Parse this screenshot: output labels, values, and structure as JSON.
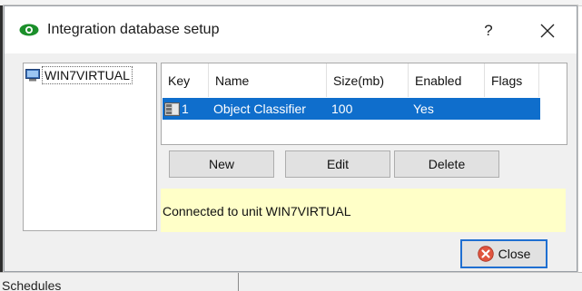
{
  "window": {
    "title": "Integration database setup",
    "help_label": "?",
    "close_icon": "close-icon",
    "title_icon": "eye-icon",
    "accent_color": "#1b8f2a"
  },
  "units": {
    "items": [
      {
        "label": "WIN7VIRTUAL",
        "icon": "computer-icon"
      }
    ]
  },
  "table": {
    "columns": [
      "Key",
      "Name",
      "Size(mb)",
      "Enabled",
      "Flags"
    ],
    "rows": [
      {
        "key": "1",
        "name": "Object Classifier",
        "size": "100",
        "enabled": "Yes",
        "flags": "",
        "icon": "database-icon",
        "selected": true
      }
    ],
    "selection_color": "#0f6ecc"
  },
  "buttons": {
    "new": "New",
    "edit": "Edit",
    "delete": "Delete",
    "close": "Close",
    "close_icon": "cancel-circle-icon"
  },
  "status": {
    "text": "Connected to unit WIN7VIRTUAL",
    "background": "#ffffc8"
  },
  "background": {
    "top_text": "~~~~~~~~~~~~~~~~~",
    "bottom_text": "Schedules"
  }
}
